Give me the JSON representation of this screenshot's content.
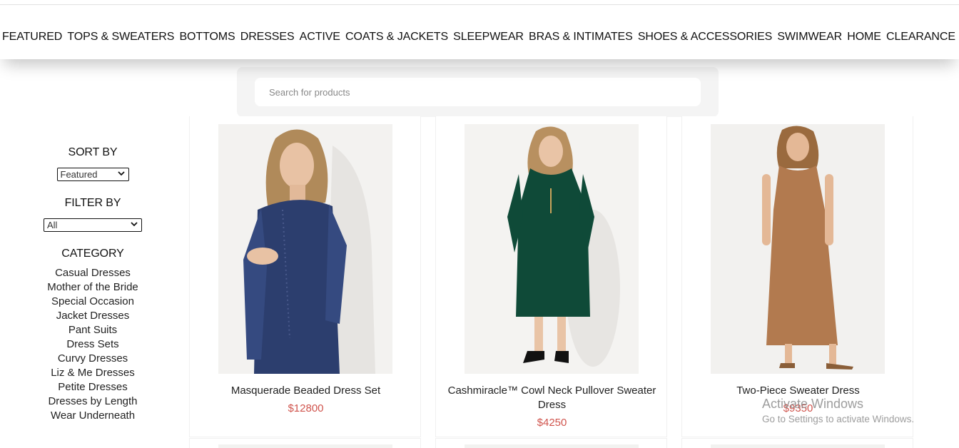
{
  "nav": {
    "items": [
      "FEATURED",
      "TOPS & SWEATERS",
      "BOTTOMS",
      "DRESSES",
      "ACTIVE",
      "COATS & JACKETS",
      "SLEEPWEAR",
      "BRAS & INTIMATES",
      "SHOES & ACCESSORIES",
      "SWIMWEAR",
      "HOME",
      "CLEARANCE"
    ]
  },
  "search": {
    "placeholder": "Search for products",
    "value": ""
  },
  "sidebar": {
    "sort_heading": "SORT BY",
    "sort_selected": "Featured",
    "filter_heading": "FILTER BY",
    "filter_selected": "All",
    "category_heading": "CATEGORY",
    "categories": [
      "Casual Dresses",
      "Mother of the Bride",
      "Special Occasion",
      "Jacket Dresses",
      "Pant Suits",
      "Dress Sets",
      "Curvy Dresses",
      "Liz & Me Dresses",
      "Petite Dresses",
      "Dresses by Length",
      "Wear Underneath"
    ]
  },
  "products": [
    {
      "name": "Masquerade Beaded Dress Set",
      "price": "$12800",
      "color": "#2c3e6e"
    },
    {
      "name": "Cashmiracle™ Cowl Neck Pullover Sweater Dress",
      "price": "$4250",
      "color": "#0f4a38"
    },
    {
      "name": "Two-Piece Sweater Dress",
      "price": "$9350",
      "color": "#b27a4f"
    }
  ],
  "watermark": {
    "title": "Activate Windows",
    "subtitle": "Go to Settings to activate Windows."
  },
  "colors": {
    "price": "#d0544d",
    "panel": "#f4f4f4"
  }
}
